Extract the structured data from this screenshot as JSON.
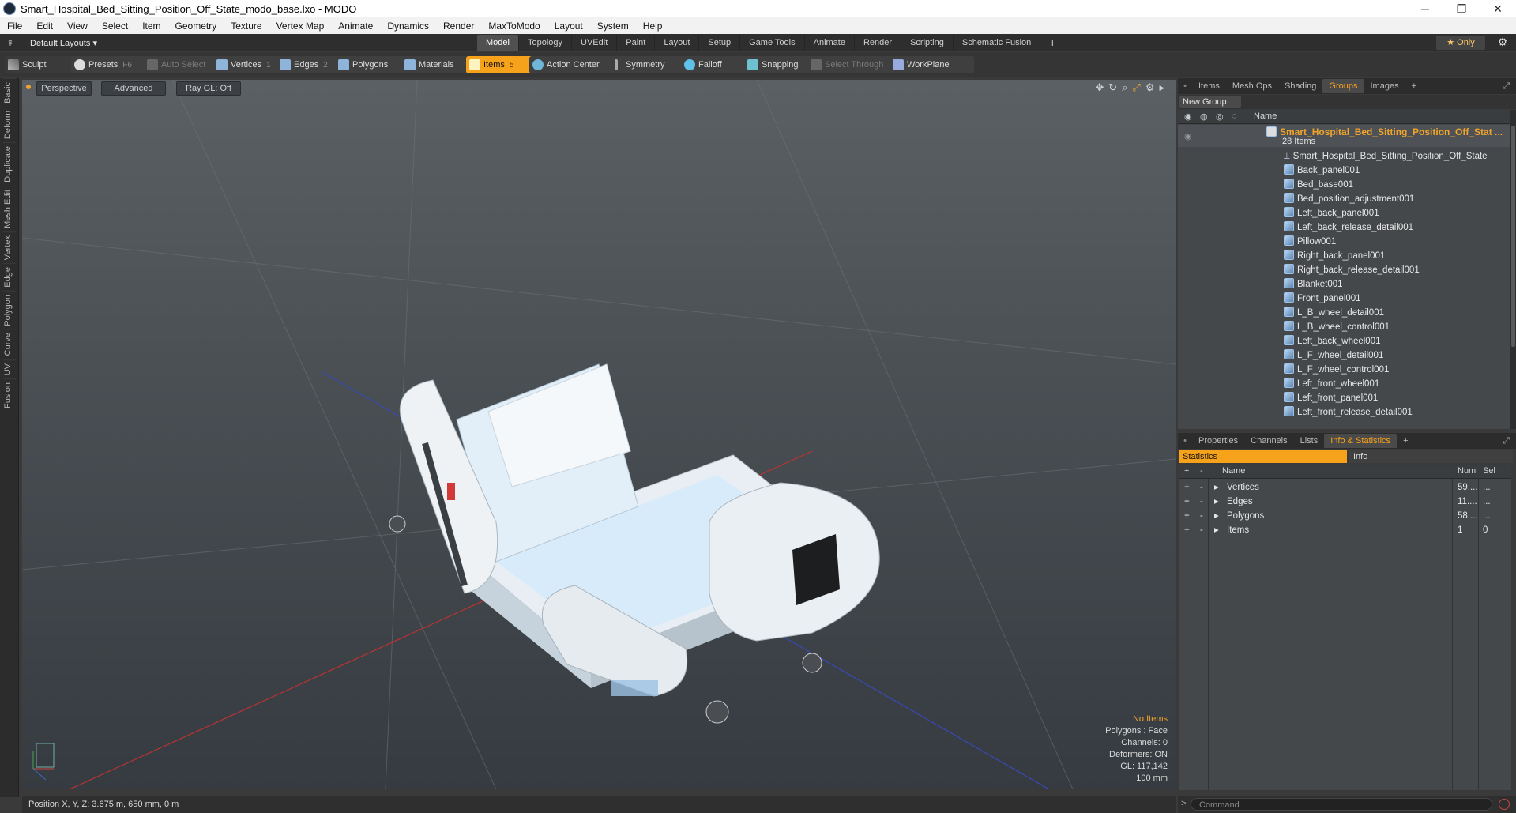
{
  "window": {
    "title": "Smart_Hospital_Bed_Sitting_Position_Off_State_modo_base.lxo - MODO",
    "minimize": "─",
    "maximize": "❐",
    "close": "✕"
  },
  "menu": [
    "File",
    "Edit",
    "View",
    "Select",
    "Item",
    "Geometry",
    "Texture",
    "Vertex Map",
    "Animate",
    "Dynamics",
    "Render",
    "MaxToModo",
    "Layout",
    "System",
    "Help"
  ],
  "layout_bar": {
    "layouts_label": "Default Layouts ▾",
    "tabs": [
      "Model",
      "Topology",
      "UVEdit",
      "Paint",
      "Layout",
      "Setup",
      "Game Tools",
      "Animate",
      "Render",
      "Scripting",
      "Schematic Fusion"
    ],
    "active_tab": "Model",
    "add_label": "+",
    "only_label": "★ Only",
    "gear": "⚙"
  },
  "toolbar": {
    "sculpt": "Sculpt",
    "presets": "Presets",
    "presets_key": "F6",
    "auto_select": "Auto Select",
    "vertices": "Vertices",
    "vertices_key": "1",
    "edges": "Edges",
    "edges_key": "2",
    "polygons": "Polygons",
    "materials": "Materials",
    "items": "Items",
    "items_key": "5",
    "action_center": "Action Center",
    "symmetry": "Symmetry",
    "falloff": "Falloff",
    "snapping": "Snapping",
    "select_through": "Select Through",
    "workplane": "WorkPlane"
  },
  "left_tabs": [
    "Basic",
    "Deform",
    "Duplicate",
    "Mesh Edit",
    "Vertex",
    "Edge",
    "Polygon",
    "Curve",
    "UV",
    "Fusion"
  ],
  "viewport": {
    "perspective": "Perspective",
    "advanced": "Advanced",
    "raygl": "Ray GL: Off",
    "info": {
      "no_items": "No Items",
      "polygons": "Polygons : Face",
      "channels": "Channels: 0",
      "deformers": "Deformers: ON",
      "gl": "GL: 117,142",
      "scale": "100 mm"
    }
  },
  "groups_panel": {
    "tabs": [
      "Items",
      "Mesh Ops",
      "Shading",
      "Groups",
      "Images"
    ],
    "active_tab": "Groups",
    "add": "+",
    "new_group": "New Group",
    "col_name": "Name",
    "group_name": "Smart_Hospital_Bed_Sitting_Position_Off_Stat ...",
    "group_count": "28 Items",
    "root_item": "Smart_Hospital_Bed_Sitting_Position_Off_State",
    "items": [
      "Back_panel001",
      "Bed_base001",
      "Bed_position_adjustment001",
      "Left_back_panel001",
      "Left_back_release_detail001",
      "Pillow001",
      "Right_back_panel001",
      "Right_back_release_detail001",
      "Blanket001",
      "Front_panel001",
      "L_B_wheel_detail001",
      "L_B_wheel_control001",
      "Left_back_wheel001",
      "L_F_wheel_detail001",
      "L_F_wheel_control001",
      "Left_front_wheel001",
      "Left_front_panel001",
      "Left_front_release_detail001"
    ]
  },
  "info_panel": {
    "tabs": [
      "Properties",
      "Channels",
      "Lists",
      "Info & Statistics"
    ],
    "active_tab": "Info & Statistics",
    "add": "+",
    "sub_statistics": "Statistics",
    "sub_info": "Info",
    "col_name": "Name",
    "col_num": "Num",
    "col_sel": "Sel",
    "rows": [
      {
        "name": "Vertices",
        "num": "59....",
        "sel": "..."
      },
      {
        "name": "Edges",
        "num": "11....",
        "sel": "..."
      },
      {
        "name": "Polygons",
        "num": "58....",
        "sel": "..."
      },
      {
        "name": "Items",
        "num": "1",
        "sel": "0"
      }
    ]
  },
  "status": {
    "position": "Position X, Y, Z:   3.675 m, 650 mm, 0 m",
    "command_placeholder": "Command"
  }
}
